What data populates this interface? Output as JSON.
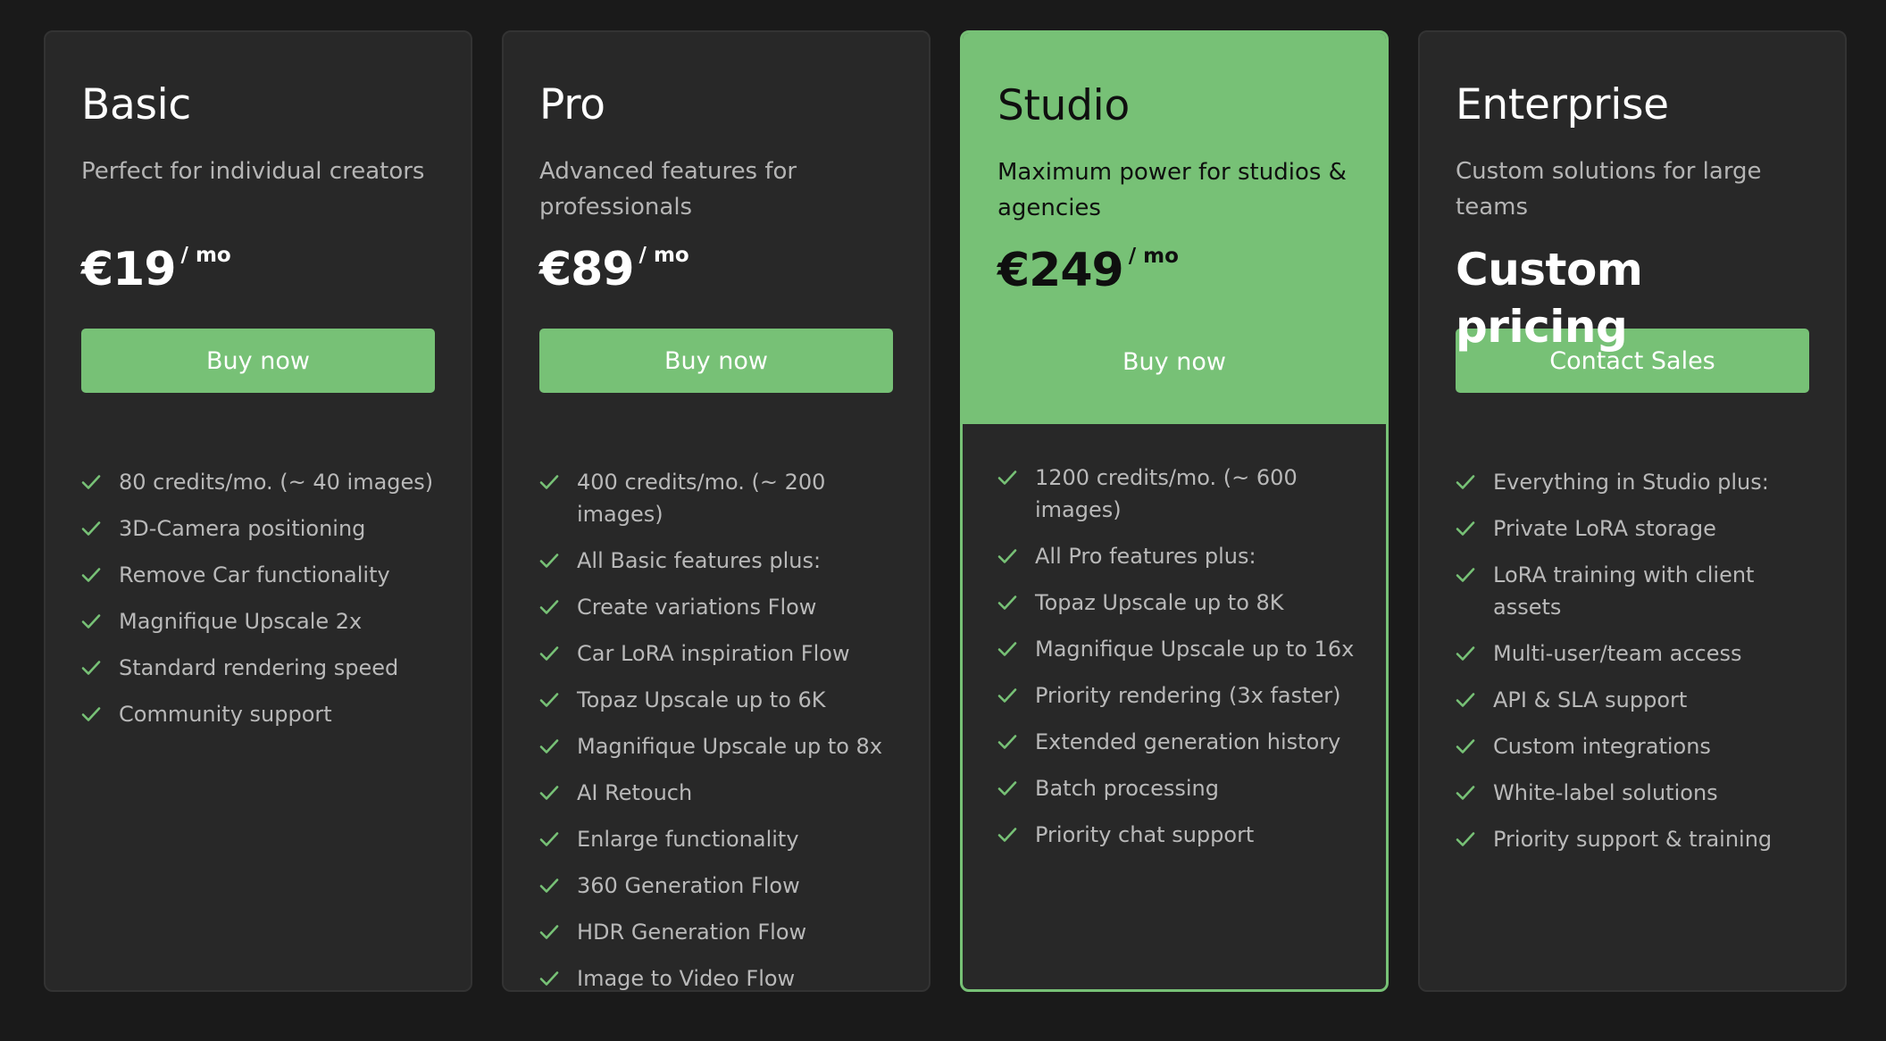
{
  "plans": [
    {
      "name": "Basic",
      "description": "Perfect for individual creators",
      "price": "€19",
      "per": "/ mo",
      "cta": "Buy now",
      "features": [
        "80 credits/mo. (~ 40 images)",
        "3D-Camera positioning",
        "Remove Car functionality",
        "Magnifique Upscale 2x",
        "Standard rendering speed",
        "Community support"
      ]
    },
    {
      "name": "Pro",
      "description": "Advanced features for professionals",
      "price": "€89",
      "per": "/ mo",
      "cta": "Buy now",
      "features": [
        "400 credits/mo. (~ 200 images)",
        "All Basic features plus:",
        "Create variations Flow",
        "Car LoRA inspiration Flow",
        "Topaz Upscale up to 6K",
        "Magnifique Upscale up to 8x",
        "AI Retouch",
        "Enlarge functionality",
        "360 Generation Flow",
        "HDR Generation Flow",
        "Image to Video Flow"
      ]
    },
    {
      "name": "Studio",
      "description": "Maximum power for studios & agencies",
      "price": "€249",
      "per": "/ mo",
      "cta": "Buy now",
      "features": [
        "1200 credits/mo. (~ 600 images)",
        "All Pro features plus:",
        "Topaz Upscale up to 8K",
        "Magnifique Upscale up to 16x",
        "Priority rendering (3x faster)",
        "Extended generation history",
        "Batch processing",
        "Priority chat support"
      ]
    },
    {
      "name": "Enterprise",
      "description": "Custom solutions for large teams",
      "price": "Custom pricing",
      "cta": "Contact Sales",
      "features": [
        "Everything in Studio plus:",
        "Private LoRA storage",
        "LoRA training with client assets",
        "Multi-user/team access",
        "API & SLA support",
        "Custom integrations",
        "White-label solutions",
        "Priority support & training"
      ]
    }
  ],
  "colors": {
    "accent": "#77c176",
    "background": "#1a1a1a",
    "card": "#282828",
    "text_muted": "#b5b5b5"
  },
  "icons": {
    "feature_bullet": "check-icon"
  }
}
